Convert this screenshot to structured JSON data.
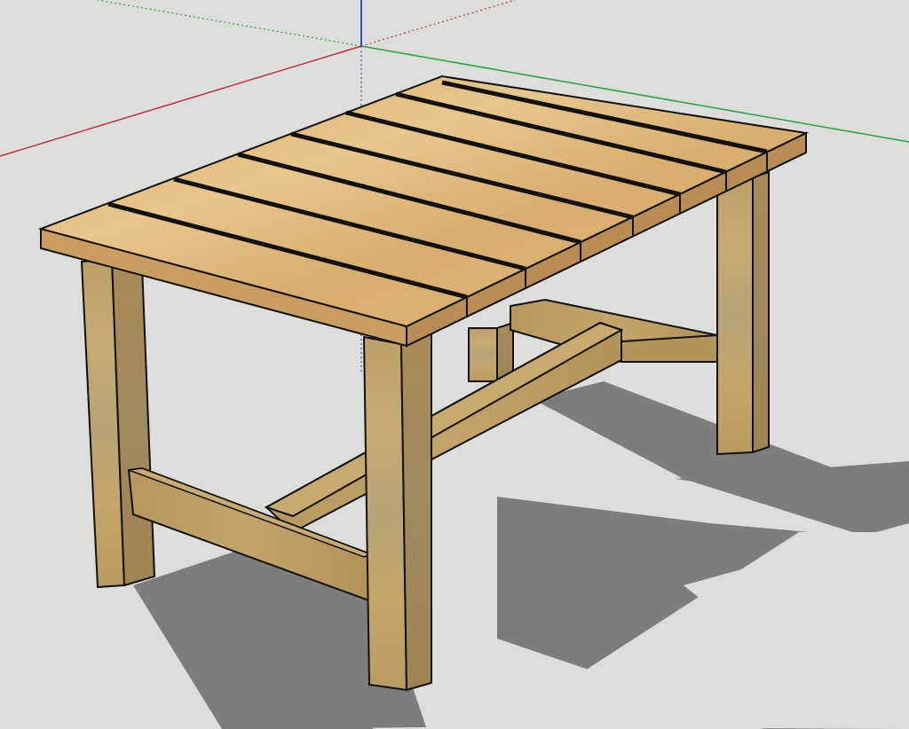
{
  "scene": {
    "model": "wooden-table",
    "background_color": "#dddddb",
    "shadow_color": "#7d7d7d",
    "outline_color": "#111111",
    "axes": {
      "x_axis_color": "#c0303a",
      "y_axis_color": "#1fa83a",
      "z_axis_color": "#2d4fd0"
    },
    "wood": {
      "top_color": "#dcae6e",
      "top_highlight": "#e7c488",
      "edge_color": "#c89a5c",
      "leg_front_color": "#c2a36c",
      "leg_side_color": "#a88a55",
      "rail_color": "#b8985e",
      "rail_side_color": "#9c7e4c"
    },
    "tabletop_board_count": 8
  }
}
